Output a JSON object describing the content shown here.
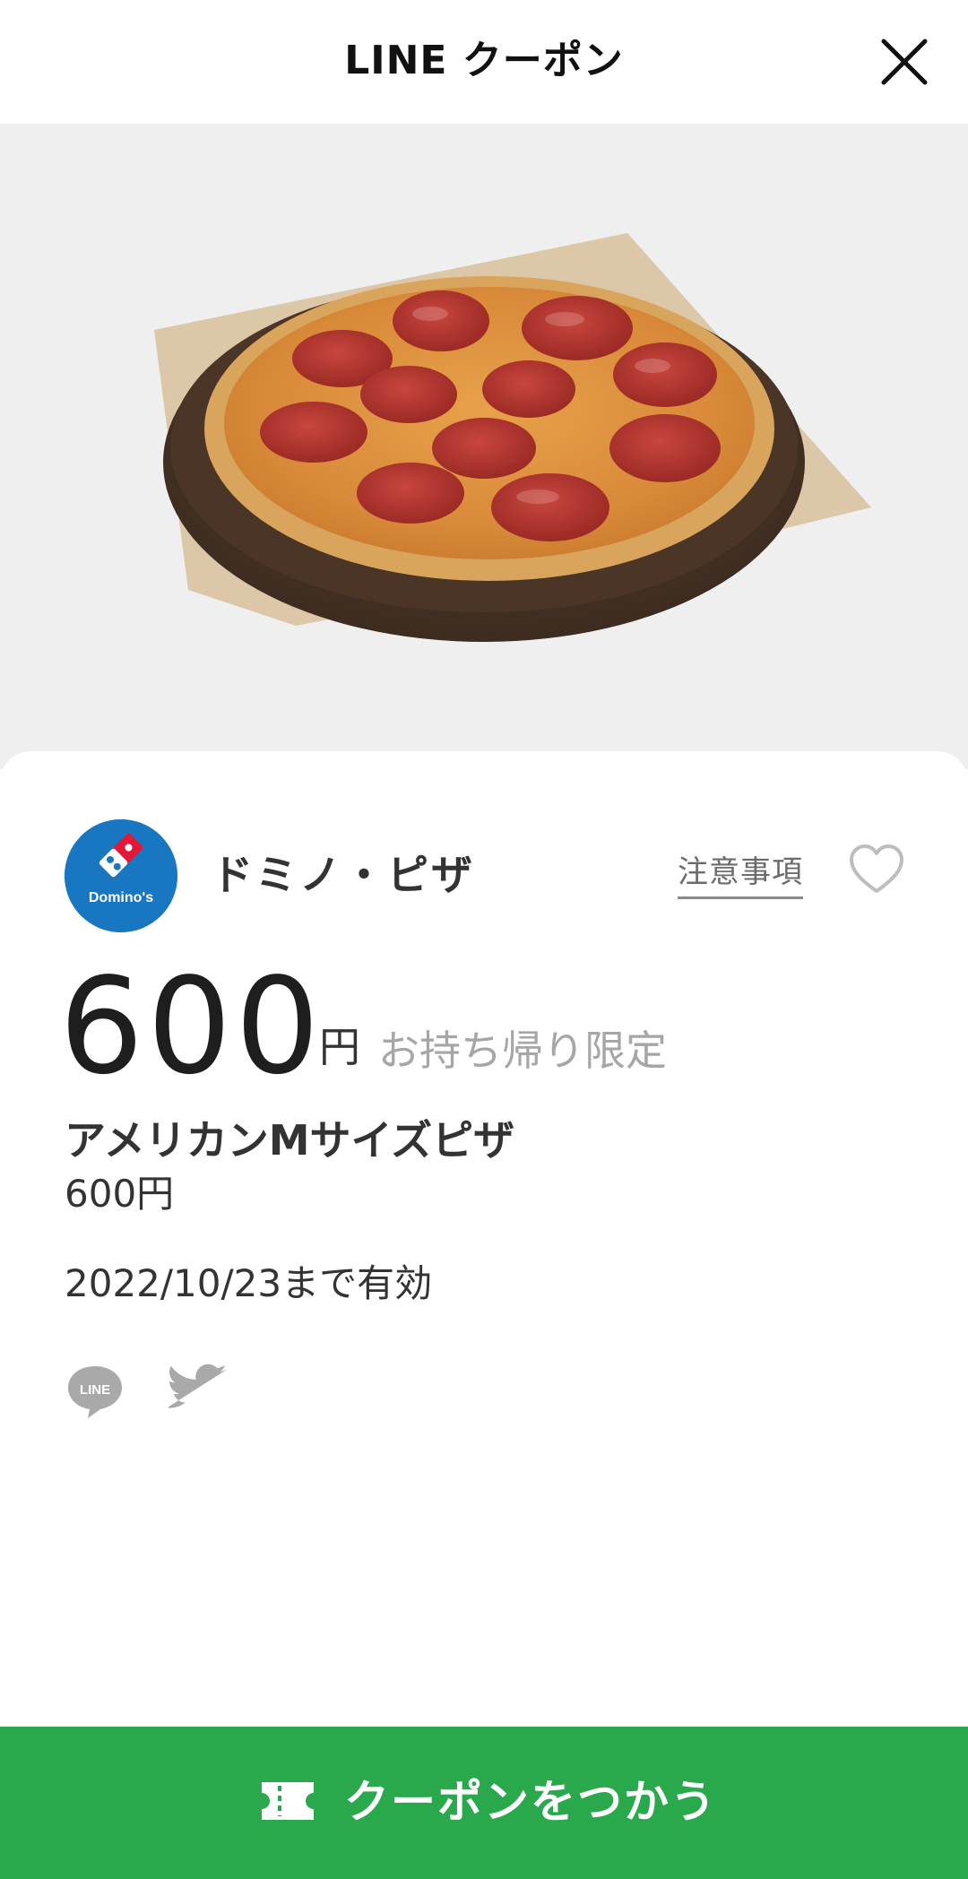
{
  "header": {
    "title": "LINE クーポン"
  },
  "hero": {
    "image_subject": "pizza"
  },
  "shop": {
    "logo_text": "Domino's",
    "name": "ドミノ・ピザ",
    "notice_label": "注意事項"
  },
  "offer": {
    "price": "600",
    "unit": "円",
    "note": "お持ち帰り限定",
    "item_name": "アメリカンMサイズピザ",
    "item_price": "600円",
    "validity": "2022/10/23まで有効"
  },
  "share": {
    "line_icon_text": "LINE"
  },
  "action": {
    "use_label": "クーポンをつかう"
  },
  "colors": {
    "accent_green": "#2aa84c",
    "brand_blue": "#1976c1",
    "brand_red": "#e31837"
  },
  "icons": {
    "close": "close-icon",
    "heart": "heart-icon",
    "line_share": "line-icon",
    "twitter_share": "twitter-icon",
    "ticket": "ticket-icon"
  }
}
